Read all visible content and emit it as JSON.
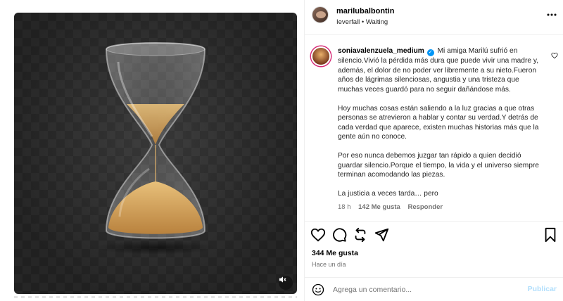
{
  "post": {
    "author": "marilubalbontin",
    "subline": "Ieverfall • Waiting"
  },
  "comment": {
    "username": "soniavalenzuela_medium",
    "paragraphs": [
      "Mi amiga Marilú sufrió en silencio.Vivió la pérdida más dura que puede vivir una madre y, además, el dolor de no poder ver libremente a su nieto.Fueron años de lágrimas silenciosas, angustia y una tristeza que muchas veces guardó para no seguir dañándose más.",
      "Hoy muchas cosas están saliendo a la luz gracias a que otras personas se atrevieron a hablar y contar su verdad.Y detrás de cada verdad que aparece, existen muchas historias más que la gente aún no conoce.",
      "Por eso nunca debemos juzgar tan rápido a quien decidió guardar silencio.Porque el tiempo, la vida y el universo siempre terminan acomodando las piezas.",
      "La justicia a veces tarda… pero"
    ],
    "time": "18 h",
    "likes": "142 Me gusta",
    "reply_label": "Responder"
  },
  "actions": {
    "likes_count": "344 Me gusta",
    "time_ago": "Hace un día"
  },
  "composer": {
    "placeholder": "Agrega un comentario...",
    "post_label": "Publicar"
  },
  "icons": {
    "like": "heart-icon",
    "comment": "comment-icon",
    "share": "repost-icon",
    "send": "send-icon",
    "save": "bookmark-icon",
    "emoji": "emoji-icon",
    "more": "more-options-icon",
    "mute": "mute-icon",
    "verified": "verified-badge-icon"
  },
  "colors": {
    "accent": "#0095f6",
    "post_disabled": "#b2dffc",
    "secondary_text": "#737373",
    "divider": "#efefef"
  }
}
